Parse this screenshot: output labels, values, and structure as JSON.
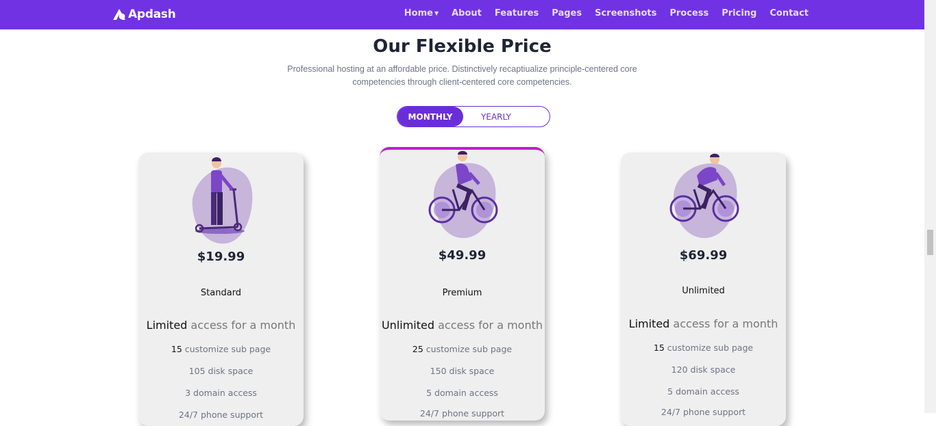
{
  "brand": {
    "name": "Apdash"
  },
  "nav": {
    "items": [
      {
        "label": "Home",
        "has_dropdown": true
      },
      {
        "label": "About"
      },
      {
        "label": "Features"
      },
      {
        "label": "Pages"
      },
      {
        "label": "Screenshots"
      },
      {
        "label": "Process"
      },
      {
        "label": "Pricing"
      },
      {
        "label": "Contact"
      }
    ]
  },
  "section": {
    "title": "Our Flexible Price",
    "subtitle_line1": "Professional hosting at an affordable price. Distinctively recaptiualize principle-centered core",
    "subtitle_line2": "competencies through client-centered core competencies."
  },
  "toggle": {
    "monthly": "MONTHLY",
    "yearly": "YEARLY",
    "active": "monthly"
  },
  "plans": [
    {
      "price": "$19.99",
      "name": "Standard",
      "access_strong": "Limited",
      "access_rest": "access for a month",
      "sub_page_count": "15",
      "sub_page_text": "customize sub page",
      "disk": "105 disk space",
      "domain": "3 domain access",
      "support": "24/7 phone support"
    },
    {
      "price": "$49.99",
      "name": "Premium",
      "access_strong": "Unlimited",
      "access_rest": "access for a month",
      "sub_page_count": "25",
      "sub_page_text": "customize sub page",
      "disk": "150 disk space",
      "domain": "5 domain access",
      "support": "24/7 phone support"
    },
    {
      "price": "$69.99",
      "name": "Unlimited",
      "access_strong": "Limited",
      "access_rest": "access for a month",
      "sub_page_count": "15",
      "sub_page_text": "customize sub page",
      "disk": "120 disk space",
      "domain": "5 domain access",
      "support": "24/7 phone support"
    }
  ],
  "colors": {
    "primary": "#7132e3",
    "accent": "#c11bd3",
    "card_bg": "#efefef"
  }
}
